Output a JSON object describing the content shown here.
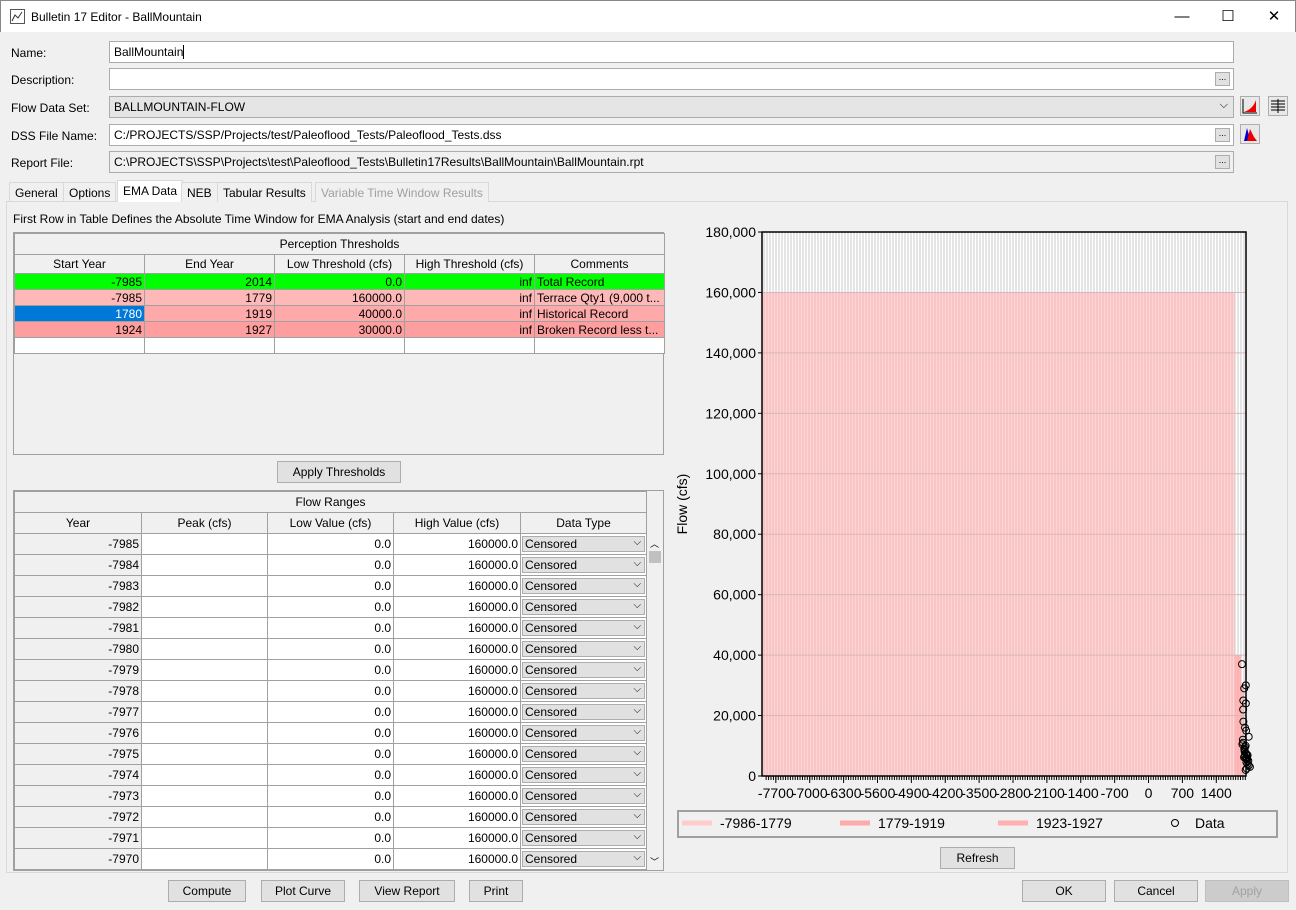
{
  "window": {
    "title": "Bulletin 17 Editor - BallMountain",
    "minimize": "—",
    "maximize": "☐",
    "close": "✕"
  },
  "form": {
    "name_label": "Name:",
    "name_value": "BallMountain",
    "description_label": "Description:",
    "description_value": "",
    "flow_label": "Flow Data Set:",
    "flow_value": "BALLMOUNTAIN-FLOW",
    "dss_label": "DSS File Name:",
    "dss_value": "C:/PROJECTS/SSP/Projects/test/Paleoflood_Tests/Paleoflood_Tests.dss",
    "report_label": "Report File:",
    "report_value": "C:\\PROJECTS\\SSP\\Projects\\test\\Paleoflood_Tests\\Bulletin17Results\\BallMountain\\BallMountain.rpt",
    "browse": "..."
  },
  "tabs": [
    {
      "label": "General"
    },
    {
      "label": "Options"
    },
    {
      "label": "EMA Data"
    },
    {
      "label": "NEB"
    },
    {
      "label": "Tabular Results"
    },
    {
      "label": "Variable Time Window Results"
    }
  ],
  "ema": {
    "note": "First Row in Table Defines the Absolute Time Window for EMA Analysis (start and end dates)",
    "perception": {
      "title": "Perception Thresholds",
      "headers": [
        "Start Year",
        "End Year",
        "Low Threshold (cfs)",
        "High Threshold (cfs)",
        "Comments"
      ],
      "rows": [
        [
          "-7985",
          "2014",
          "0.0",
          "inf",
          "Total Record"
        ],
        [
          "-7985",
          "1779",
          "160000.0",
          "inf",
          "Terrace Qty1 (9,000 t..."
        ],
        [
          "1780",
          "1919",
          "40000.0",
          "inf",
          "Historical Record"
        ],
        [
          "1924",
          "1927",
          "30000.0",
          "inf",
          "Broken Record less t..."
        ]
      ]
    },
    "apply_label": "Apply Thresholds",
    "flow_ranges": {
      "title": "Flow Ranges",
      "headers": [
        "Year",
        "Peak (cfs)",
        "Low Value (cfs)",
        "High Value (cfs)",
        "Data Type"
      ],
      "rows": [
        [
          "-7985",
          "",
          "0.0",
          "160000.0",
          "Censored"
        ],
        [
          "-7984",
          "",
          "0.0",
          "160000.0",
          "Censored"
        ],
        [
          "-7983",
          "",
          "0.0",
          "160000.0",
          "Censored"
        ],
        [
          "-7982",
          "",
          "0.0",
          "160000.0",
          "Censored"
        ],
        [
          "-7981",
          "",
          "0.0",
          "160000.0",
          "Censored"
        ],
        [
          "-7980",
          "",
          "0.0",
          "160000.0",
          "Censored"
        ],
        [
          "-7979",
          "",
          "0.0",
          "160000.0",
          "Censored"
        ],
        [
          "-7978",
          "",
          "0.0",
          "160000.0",
          "Censored"
        ],
        [
          "-7977",
          "",
          "0.0",
          "160000.0",
          "Censored"
        ],
        [
          "-7976",
          "",
          "0.0",
          "160000.0",
          "Censored"
        ],
        [
          "-7975",
          "",
          "0.0",
          "160000.0",
          "Censored"
        ],
        [
          "-7974",
          "",
          "0.0",
          "160000.0",
          "Censored"
        ],
        [
          "-7973",
          "",
          "0.0",
          "160000.0",
          "Censored"
        ],
        [
          "-7972",
          "",
          "0.0",
          "160000.0",
          "Censored"
        ],
        [
          "-7971",
          "",
          "0.0",
          "160000.0",
          "Censored"
        ],
        [
          "-7970",
          "",
          "0.0",
          "160000.0",
          "Censored"
        ]
      ]
    }
  },
  "chart_data": {
    "type": "bar",
    "ylabel": "Flow (cfs)",
    "xlabel": "",
    "xlim": [
      -7986,
      2014
    ],
    "ylim": [
      0,
      180000
    ],
    "xticks": [
      -7700,
      -7000,
      -6300,
      -5600,
      -4900,
      -4200,
      -3500,
      -2800,
      -2100,
      -1400,
      -700,
      0,
      700,
      1400
    ],
    "yticks": [
      0,
      20000,
      40000,
      60000,
      80000,
      100000,
      120000,
      140000,
      160000,
      180000
    ],
    "ytick_labels": [
      "0",
      "20,000",
      "40,000",
      "60,000",
      "80,000",
      "100,000",
      "120,000",
      "140,000",
      "160,000",
      "180,000"
    ],
    "grid": true,
    "legend_position": "bottom",
    "thresholds": [
      {
        "name": "-7986-1779",
        "start": -7986,
        "end": 1779,
        "value": 160000,
        "color": "#ffcccc"
      },
      {
        "name": "1779-1919",
        "start": 1779,
        "end": 1919,
        "value": 40000,
        "color": "#ffaaaa"
      },
      {
        "name": "1923-1927",
        "start": 1923,
        "end": 1927,
        "value": 30000,
        "color": "#ffb0b0"
      }
    ],
    "data_series": {
      "name": "Data",
      "points": [
        [
          1869,
          37000
        ],
        [
          1927,
          30000
        ],
        [
          1936,
          29000
        ],
        [
          1938,
          25000
        ],
        [
          1949,
          24000
        ],
        [
          1955,
          22000
        ],
        [
          1960,
          18000
        ],
        [
          1973,
          16000
        ],
        [
          1976,
          15000
        ],
        [
          1987,
          13000
        ],
        [
          1928,
          12000
        ],
        [
          1933,
          11000
        ],
        [
          1940,
          10500
        ],
        [
          1944,
          10000
        ],
        [
          1951,
          9500
        ],
        [
          1958,
          9000
        ],
        [
          1963,
          8500
        ],
        [
          1968,
          8000
        ],
        [
          1971,
          7500
        ],
        [
          1979,
          7000
        ],
        [
          1984,
          6800
        ],
        [
          1990,
          6500
        ],
        [
          1993,
          6000
        ],
        [
          1996,
          5500
        ],
        [
          1999,
          5000
        ],
        [
          2003,
          4500
        ],
        [
          2006,
          4000
        ],
        [
          2009,
          3500
        ],
        [
          2012,
          3000
        ],
        [
          1947,
          2500
        ],
        [
          1966,
          2000
        ],
        [
          1981,
          7200
        ],
        [
          1953,
          6200
        ],
        [
          1942,
          5800
        ]
      ]
    }
  },
  "chart": {
    "refresh_label": "Refresh"
  },
  "footer": {
    "compute": "Compute",
    "plot_curve": "Plot Curve",
    "view_report": "View Report",
    "print": "Print",
    "ok": "OK",
    "cancel": "Cancel",
    "apply": "Apply"
  }
}
